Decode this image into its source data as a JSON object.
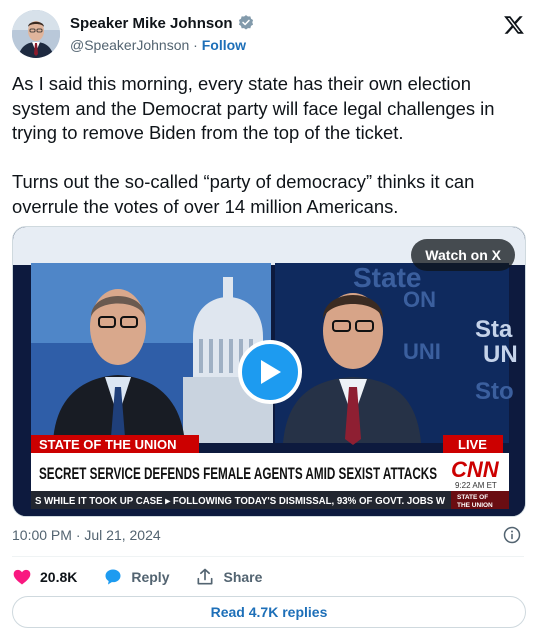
{
  "author": {
    "name": "Speaker Mike Johnson",
    "handle": "@SpeakerJohnson",
    "separator": " · ",
    "follow_label": "Follow"
  },
  "tweet": {
    "text": "As I said this morning, every state has their own election system and the Democrat party will face legal challenges in trying to remove Biden from the top of the ticket.\n\nTurns out the so-called “party of democracy” thinks it can overrule the votes of over 14 million Americans.",
    "timestamp": "10:00 PM · Jul 21, 2024"
  },
  "media": {
    "watch_label": "Watch on X",
    "lower_third": {
      "program": "STATE OF THE UNION",
      "live": "LIVE",
      "headline": "SECRET SERVICE DEFENDS FEMALE AGENTS AMID SEXIST ATTACKS",
      "network": "CNN",
      "time": "9:22 AM ET",
      "ticker": "S WHILE IT TOOK UP CASE  ▸ FOLLOWING TODAY'S DISMISSAL, 93% OF GOVT. JOBS W",
      "bug_line1": "STATE OF",
      "bug_line2": "THE UNION"
    },
    "backdrop_text": [
      "State",
      "ON",
      "Sta",
      "UN",
      "UNI",
      "Sto"
    ]
  },
  "actions": {
    "likes": "20.8K",
    "reply_label": "Reply",
    "share_label": "Share"
  },
  "replies_button": "Read 4.7K replies",
  "colors": {
    "accent": "#1d9bf0",
    "link": "#1d6fb8",
    "like": "#f91880",
    "cnn_red": "#cc0000"
  }
}
